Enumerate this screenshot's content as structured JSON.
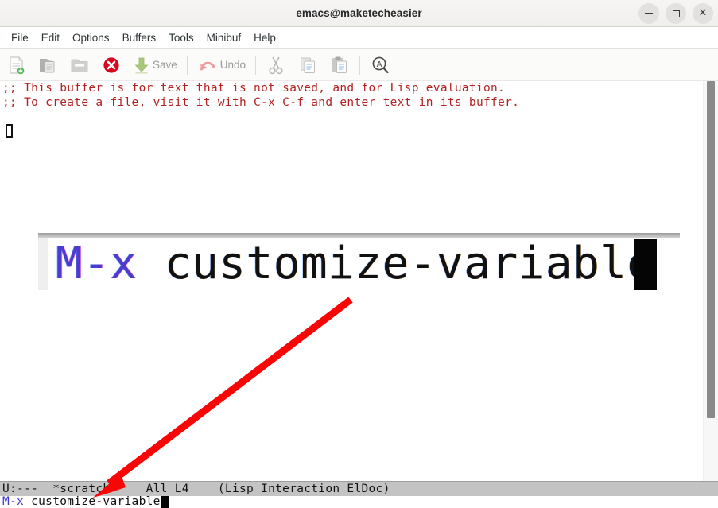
{
  "window": {
    "title": "emacs@maketecheasier",
    "controls": [
      {
        "name": "minimize",
        "label": "–"
      },
      {
        "name": "maximize",
        "label": "□"
      },
      {
        "name": "close",
        "label": "×"
      }
    ]
  },
  "menubar": {
    "items": [
      {
        "label": "File"
      },
      {
        "label": "Edit"
      },
      {
        "label": "Options"
      },
      {
        "label": "Buffers"
      },
      {
        "label": "Tools"
      },
      {
        "label": "Minibuf"
      },
      {
        "label": "Help"
      }
    ]
  },
  "toolbar": {
    "items": [
      {
        "icon": "new-file-icon",
        "label": ""
      },
      {
        "icon": "open-file-icon",
        "label": ""
      },
      {
        "icon": "folder-icon",
        "label": ""
      },
      {
        "icon": "close-buffer-icon",
        "label": ""
      },
      {
        "icon": "save-icon",
        "label": "Save"
      },
      {
        "icon": "undo-icon",
        "label": "Undo"
      },
      {
        "icon": "cut-icon",
        "label": ""
      },
      {
        "icon": "copy-icon",
        "label": ""
      },
      {
        "icon": "paste-icon",
        "label": ""
      },
      {
        "icon": "search-icon",
        "label": ""
      }
    ]
  },
  "buffer": {
    "line1": ";; This buffer is for text that is not saved, and for Lisp evaluation.",
    "line2": ";; To create a file, visit it with C-x C-f and enter text in its buffer.",
    "text_color": "#b22222"
  },
  "magnifier": {
    "prefix": "M-x",
    "command": " customize-variable",
    "prefix_color": "#4a3ccf",
    "command_color": "#111111"
  },
  "modeline": {
    "status": "U:---",
    "buffer_name": "*scratch*",
    "position": "All L4",
    "modes": "(Lisp Interaction ElDoc)",
    "full": "U:---  *scratch*    All L4    (Lisp Interaction ElDoc)",
    "background": "#c3c3c3"
  },
  "minibuffer": {
    "prefix": "M-x",
    "value": " customize-variable",
    "prefix_color": "#3b3bd6"
  },
  "annotation": {
    "arrow_color": "#f90505",
    "description": "red arrow pointing to minibuffer"
  }
}
